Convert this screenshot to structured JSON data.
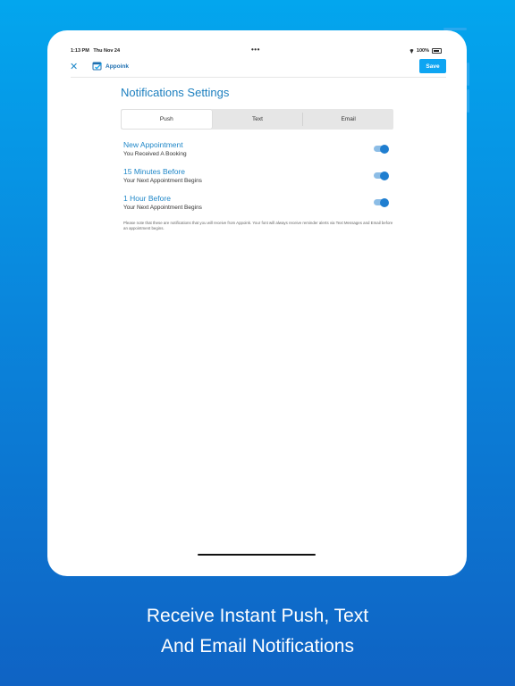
{
  "status_bar": {
    "time": "1:13 PM",
    "date": "Thu Nov 24",
    "dots": "•••",
    "battery": "100%"
  },
  "nav": {
    "close_icon": "close-icon",
    "brand": "Appoink",
    "save_label": "Save"
  },
  "page": {
    "title": "Notifications Settings",
    "tabs": [
      {
        "label": "Push",
        "selected": true
      },
      {
        "label": "Text",
        "selected": false
      },
      {
        "label": "Email",
        "selected": false
      }
    ],
    "settings": [
      {
        "title": "New Appointment",
        "subtitle": "You Received A Booking",
        "enabled": true
      },
      {
        "title": "15 Minutes Before",
        "subtitle": "Your Next Appointment Begins",
        "enabled": true
      },
      {
        "title": "1 Hour Before",
        "subtitle": "Your Next Appointment Begins",
        "enabled": true
      }
    ],
    "note": "Please note that these are notifications that you will receive from Appoink. Your font will always receive reminder alerts via Text Messages and Email before an appointment begins."
  },
  "caption": {
    "line1": "Receive Instant Push, Text",
    "line2": "And Email Notifications"
  },
  "colors": {
    "accent": "#0ea5f2",
    "title_blue": "#1c7fbf",
    "toggle_on": "#1f7ed0"
  }
}
